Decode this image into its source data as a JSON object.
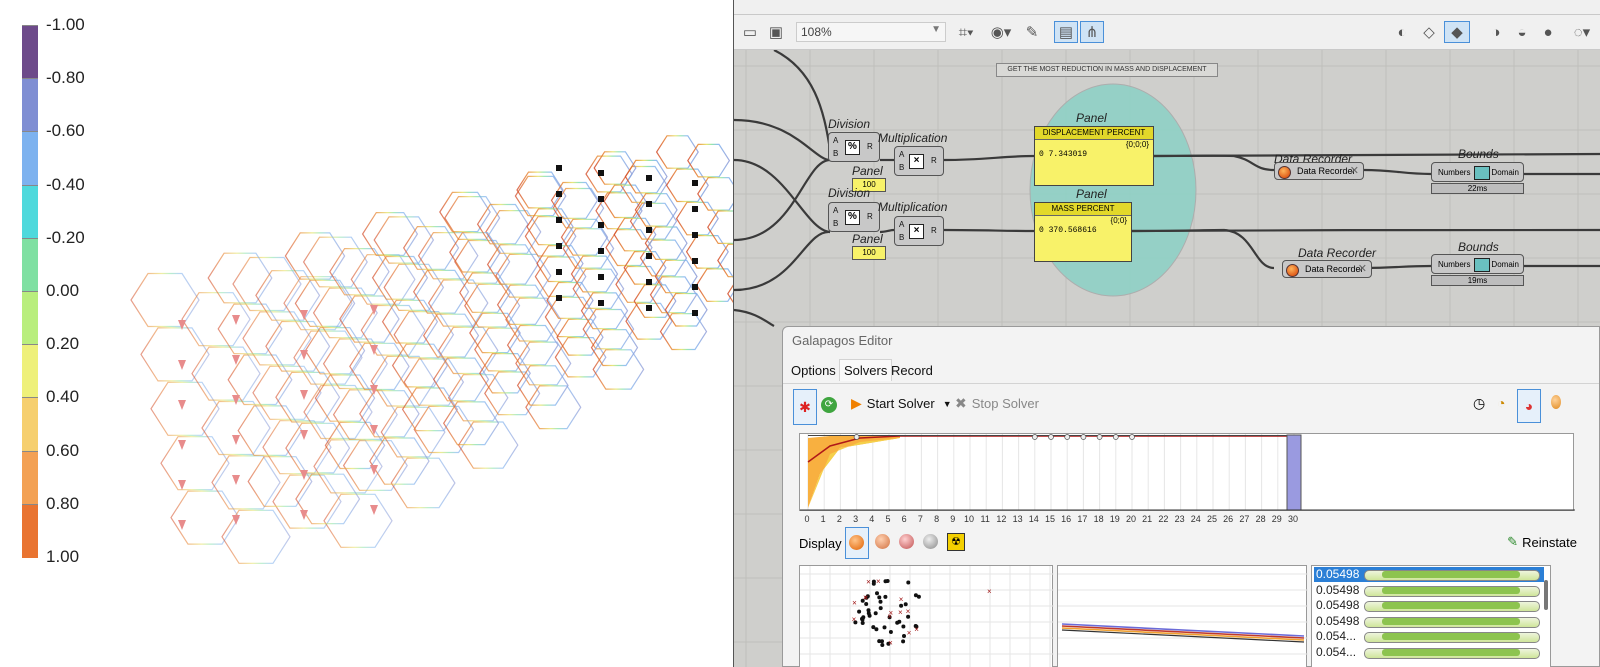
{
  "legend": {
    "labels": [
      "-1.00",
      "-0.80",
      "-0.60",
      "-0.40",
      "-0.20",
      "0.00",
      "0.20",
      "0.40",
      "0.60",
      "0.80",
      "1.00"
    ],
    "colors": [
      "#6d4a8a",
      "#7f8ed3",
      "#7db2ef",
      "#4ed9dc",
      "#7fe0a2",
      "#b9ee7d",
      "#eef07a",
      "#f6cf6e",
      "#f3a154",
      "#e97431"
    ]
  },
  "toolbar": {
    "zoom": "108%",
    "icons": [
      "open-file-icon",
      "save-icon",
      "zoom-field",
      "zoom-extents-icon",
      "preview-eye-icon",
      "sketch-icon",
      "preview-mode-icon",
      "shade-icon",
      "wireframe-icon",
      "rendered-icon",
      "mesh-icon",
      "sphere-icon"
    ]
  },
  "canvas": {
    "group_label": "GET THE MOST REDUCTION IN MASS AND DISPLACEMENT",
    "division_title": "Division",
    "multiplication_title": "Multiplication",
    "panel_title": "Panel",
    "small_panel_value": "100",
    "displacement_panel": {
      "header": "DISPLACEMENT PERCENT",
      "path": "{0;0;0}",
      "index": "0",
      "value": "7.343019"
    },
    "mass_panel": {
      "header": "MASS PERCENT",
      "path": "{0;0}",
      "index": "0",
      "value": "370.568616"
    },
    "recorder_title": "Data Recorder",
    "recorder_label": "Data Recorder",
    "bounds_title": "Bounds",
    "bounds_in": "Numbers",
    "bounds_out": "Domain",
    "timing1": "22ms",
    "timing2": "19ms",
    "port_a": "A",
    "port_b": "B",
    "port_r": "R"
  },
  "galapagos": {
    "title": "Galapagos Editor",
    "tabs": [
      "Options",
      "Solvers",
      "Record"
    ],
    "start_label": "Start Solver",
    "stop_label": "Stop Solver",
    "display_label": "Display",
    "reinstate_label": "Reinstate",
    "generations": [
      "0",
      "1",
      "2",
      "3",
      "4",
      "5",
      "6",
      "7",
      "8",
      "9",
      "10",
      "11",
      "12",
      "13",
      "14",
      "15",
      "16",
      "17",
      "18",
      "19",
      "20",
      "21",
      "22",
      "23",
      "24",
      "25",
      "26",
      "27",
      "28",
      "29",
      "30"
    ],
    "fitness_values": [
      "0.05498",
      "0.05498",
      "0.05498",
      "0.05498",
      "0.054...",
      "0.054..."
    ]
  }
}
